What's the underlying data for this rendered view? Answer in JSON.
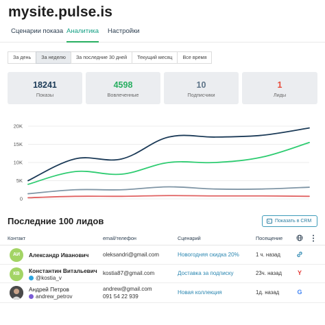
{
  "site": {
    "title": "mysite.pulse.is"
  },
  "tabs": [
    {
      "label": "Сценарии показа",
      "active": false
    },
    {
      "label": "Аналитика",
      "active": true
    },
    {
      "label": "Настройки",
      "active": false
    }
  ],
  "ranges": [
    {
      "label": "За день",
      "active": false
    },
    {
      "label": "За неделю",
      "active": true
    },
    {
      "label": "За последние 30 дней",
      "active": false
    },
    {
      "label": "Текущий месяц",
      "active": false
    },
    {
      "label": "Все время",
      "active": false
    }
  ],
  "stats": [
    {
      "value": "18241",
      "label": "Показы",
      "color": "#1b3a57"
    },
    {
      "value": "4598",
      "label": "Вовлеченные",
      "color": "#27ae60"
    },
    {
      "value": "10",
      "label": "Подписчики",
      "color": "#5d7488"
    },
    {
      "value": "1",
      "label": "Лиды",
      "color": "#e74c3c"
    }
  ],
  "chart_data": {
    "type": "line",
    "yticks": [
      "0",
      "5K",
      "10K",
      "15K",
      "20K"
    ],
    "ylim": [
      0,
      20000
    ],
    "grid": true,
    "legend": "none",
    "x": [
      0,
      1,
      2,
      3,
      4,
      5,
      6
    ],
    "series": [
      {
        "color": "#1b3a57",
        "values": [
          5000,
          11000,
          11000,
          17000,
          17000,
          17500,
          19500
        ]
      },
      {
        "color": "#2ecc71",
        "values": [
          4000,
          7500,
          6800,
          10000,
          10000,
          11500,
          15500
        ]
      },
      {
        "color": "#7f95a5",
        "values": [
          1400,
          2500,
          2500,
          3300,
          2700,
          2700,
          3200
        ]
      },
      {
        "color": "#e06060",
        "values": [
          300,
          700,
          700,
          900,
          800,
          800,
          700
        ]
      }
    ]
  },
  "leads": {
    "title": "Последние 100 лидов",
    "crm_button": "Показать в CRM",
    "columns": [
      "Контакт",
      "email/телефон",
      "Сценарий",
      "Посещение"
    ],
    "rows": [
      {
        "initials": "АИ",
        "avatar_color": "#a3d465",
        "name": "Александр Иванович",
        "handle": "",
        "contact": [
          "oleksandri@gmail.com"
        ],
        "scenario": "Новогодняя скидка 20%",
        "visit": "1 ч. назад",
        "source_icon": "link-icon",
        "source_glyph": "🔗",
        "source_color": "#2a86b0"
      },
      {
        "initials": "КВ",
        "avatar_color": "#a3d465",
        "name": "Константин Витальевич",
        "handle": "@kostia_v",
        "contact": [
          "kostia87@gmail.com"
        ],
        "scenario": "Доставка за подписку",
        "visit": "23ч. назад",
        "source_icon": "yandex-icon",
        "source_glyph": "Y",
        "source_color": "#e53935"
      },
      {
        "initials": "",
        "avatar_color": "#3b3b3b",
        "name": "Андрей Петров",
        "handle": "andrew_petrov",
        "contact": [
          "andrew@gmail.com",
          "091 54 22 939"
        ],
        "scenario": "Новая коллекция",
        "visit": "1д. назад",
        "source_icon": "google-icon",
        "source_glyph": "G",
        "source_color": "#4285f4"
      }
    ]
  }
}
